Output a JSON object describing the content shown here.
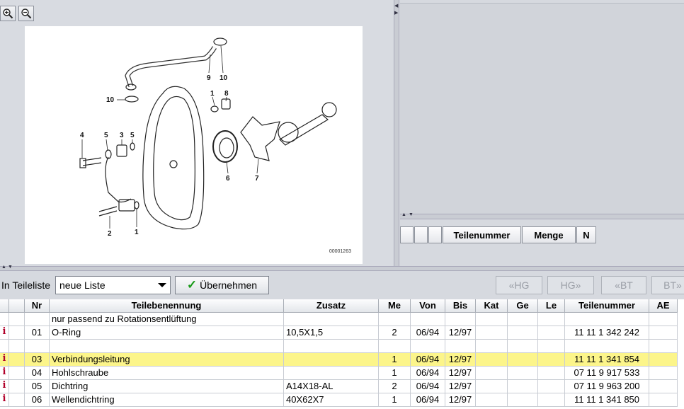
{
  "drawing": {
    "code": "00001263",
    "callouts": [
      "9",
      "10",
      "10",
      "1",
      "8",
      "4",
      "5",
      "3",
      "5",
      "6",
      "7",
      "2",
      "1"
    ]
  },
  "right_list": {
    "columns": [
      "",
      "",
      "",
      "Teilenummer",
      "Menge",
      "N"
    ]
  },
  "toolbar": {
    "teileliste_label": "In Teileliste",
    "list_value": "neue Liste",
    "apply_label": "Übernehmen",
    "nav": [
      "«HG",
      "HG»",
      "«BT",
      "BT»"
    ]
  },
  "table": {
    "columns": [
      "",
      "",
      "Nr",
      "Teilebenennung",
      "Zusatz",
      "Me",
      "Von",
      "Bis",
      "Kat",
      "Ge",
      "Le",
      "Teilenummer",
      "AE"
    ],
    "rows": [
      {
        "info": "",
        "nr": "",
        "name": "nur passend zu Rotationsentlüftung",
        "zusatz": "",
        "me": "",
        "von": "",
        "bis": "",
        "kat": "",
        "ge": "",
        "le": "",
        "teilenummer": "",
        "ae": "",
        "highlight": false
      },
      {
        "info": "i",
        "nr": "01",
        "name": "O-Ring",
        "zusatz": "10,5X1,5",
        "me": "2",
        "von": "06/94",
        "bis": "12/97",
        "kat": "",
        "ge": "",
        "le": "",
        "teilenummer": "11 11 1 342 242",
        "ae": "",
        "highlight": false
      },
      {
        "info": "",
        "nr": "",
        "name": "",
        "zusatz": "",
        "me": "",
        "von": "",
        "bis": "",
        "kat": "",
        "ge": "",
        "le": "",
        "teilenummer": "",
        "ae": "",
        "highlight": false
      },
      {
        "info": "i",
        "nr": "03",
        "name": "Verbindungsleitung",
        "zusatz": "",
        "me": "1",
        "von": "06/94",
        "bis": "12/97",
        "kat": "",
        "ge": "",
        "le": "",
        "teilenummer": "11 11 1 341 854",
        "ae": "",
        "highlight": true
      },
      {
        "info": "i",
        "nr": "04",
        "name": "Hohlschraube",
        "zusatz": "",
        "me": "1",
        "von": "06/94",
        "bis": "12/97",
        "kat": "",
        "ge": "",
        "le": "",
        "teilenummer": "07 11 9 917 533",
        "ae": "",
        "highlight": false
      },
      {
        "info": "i",
        "nr": "05",
        "name": "Dichtring",
        "zusatz": "A14X18-AL",
        "me": "2",
        "von": "06/94",
        "bis": "12/97",
        "kat": "",
        "ge": "",
        "le": "",
        "teilenummer": "07 11 9 963 200",
        "ae": "",
        "highlight": false
      },
      {
        "info": "i",
        "nr": "06",
        "name": "Wellendichtring",
        "zusatz": "40X62X7",
        "me": "1",
        "von": "06/94",
        "bis": "12/97",
        "kat": "",
        "ge": "",
        "le": "",
        "teilenummer": "11 11 1 341 850",
        "ae": "",
        "highlight": false
      }
    ]
  }
}
